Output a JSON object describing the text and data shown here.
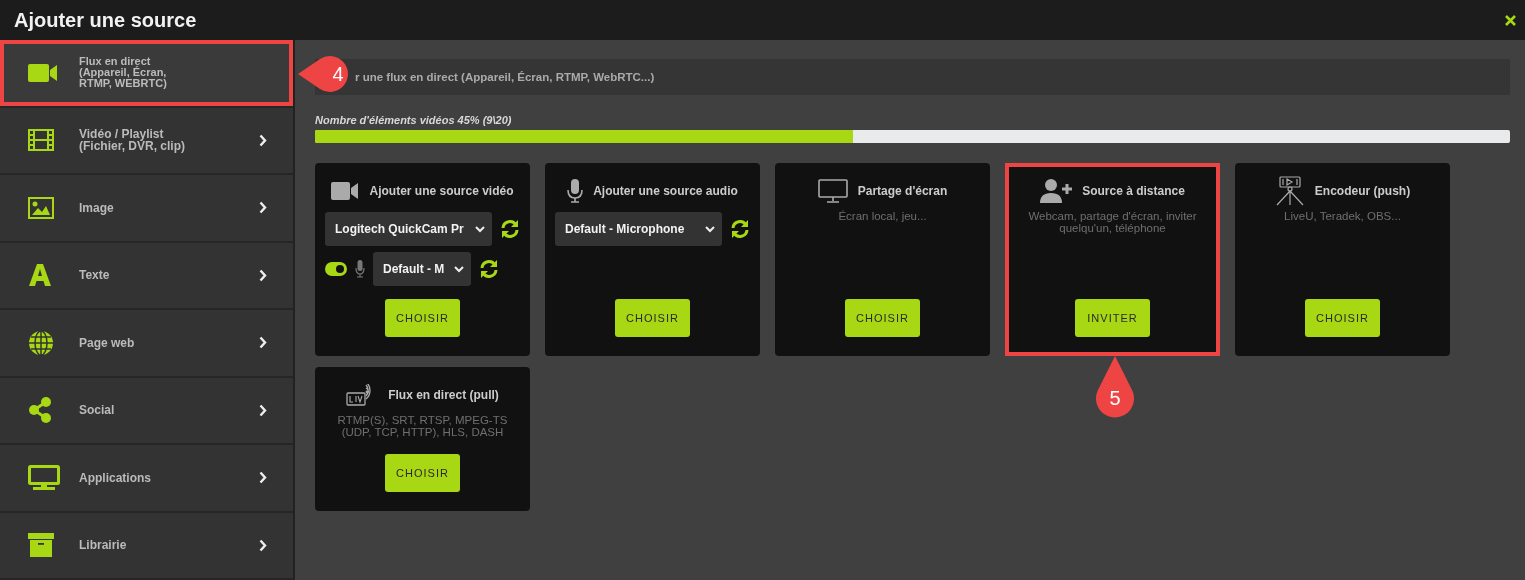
{
  "window": {
    "title": "Ajouter une source"
  },
  "sidebar": {
    "items": [
      {
        "kind": "camera",
        "lines": [
          "Flux en direct",
          "(Appareil, Écran,",
          "RTMP, WEBRTC)"
        ],
        "selected": true,
        "callout": "4"
      },
      {
        "kind": "film",
        "lines": [
          "Vidéo / Playlist",
          "(Fichier, DVR, clip)"
        ],
        "selected": false
      },
      {
        "kind": "image",
        "lines": [
          "Image"
        ],
        "selected": false
      },
      {
        "kind": "text",
        "lines": [
          "Texte"
        ],
        "selected": false
      },
      {
        "kind": "globe",
        "lines": [
          "Page web"
        ],
        "selected": false
      },
      {
        "kind": "share",
        "lines": [
          "Social"
        ],
        "selected": false
      },
      {
        "kind": "monitor",
        "lines": [
          "Applications"
        ],
        "selected": false
      },
      {
        "kind": "archive",
        "lines": [
          "Librairie"
        ],
        "selected": false
      }
    ]
  },
  "search": {
    "placeholder": "r une flux en direct (Appareil, Écran, RTMP, WebRTC...)"
  },
  "quota": {
    "label": "Nombre d'éléments vidéos 45% (9\\20)",
    "level": 0.45
  },
  "cards": [
    {
      "kind": "video",
      "title": "Ajouter une source vidéo",
      "camera_select": "Logitech QuickCam Pr",
      "mic_on": true,
      "mic_select": "Default - M",
      "button": "CHOISIR",
      "highlighted": false
    },
    {
      "kind": "audio",
      "title": "Ajouter une source audio",
      "select": "Default - Microphone",
      "button": "CHOISIR",
      "highlighted": false
    },
    {
      "kind": "screen",
      "title": "Partage d'écran",
      "description": "Écran local, jeu...",
      "button": "CHOISIR",
      "highlighted": false
    },
    {
      "kind": "remote",
      "title": "Source à distance",
      "description": "Webcam, partage d'écran, inviter quelqu'un, téléphone",
      "button": "INVITER",
      "highlighted": true,
      "callout": "5"
    },
    {
      "kind": "encoder",
      "title": "Encodeur (push)",
      "description": "LiveU, Teradek, OBS...",
      "button": "CHOISIR",
      "highlighted": false
    },
    {
      "kind": "pull",
      "title": "Flux en direct (pull)",
      "description": "RTMP(S), SRT, RTSP, MPEG-TS (UDP, TCP, HTTP), HLS, DASH",
      "button": "CHOISIR",
      "highlighted": false
    }
  ]
}
